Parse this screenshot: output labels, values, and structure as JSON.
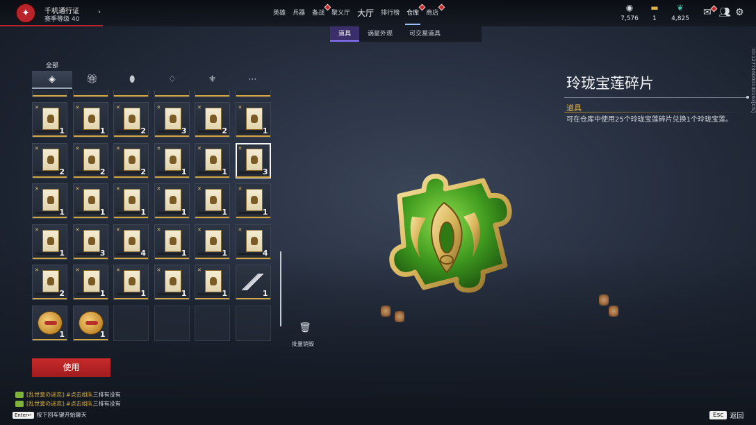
{
  "topbar": {
    "pass_title": "千机通行证",
    "pass_level": "赛季等级 40",
    "nav": [
      {
        "label": "英雄",
        "dot": false,
        "big": false,
        "active": false
      },
      {
        "label": "兵器",
        "dot": false,
        "big": false,
        "active": false
      },
      {
        "label": "备战",
        "dot": true,
        "big": false,
        "active": false
      },
      {
        "label": "聚义厅",
        "dot": false,
        "big": false,
        "active": false
      },
      {
        "label": "大厅",
        "dot": false,
        "big": true,
        "active": false
      },
      {
        "label": "排行榜",
        "dot": false,
        "big": false,
        "active": false
      },
      {
        "label": "仓库",
        "dot": true,
        "big": false,
        "active": true
      },
      {
        "label": "商店",
        "dot": true,
        "big": false,
        "active": false
      }
    ],
    "currencies": [
      {
        "icon": "mask-coin-icon",
        "value": "7,576"
      },
      {
        "icon": "ticket-icon",
        "value": "1"
      },
      {
        "icon": "feather-gem-icon",
        "value": "4,825"
      }
    ]
  },
  "subtabs": [
    {
      "label": "道具",
      "active": true
    },
    {
      "label": "谪星外观",
      "active": false
    },
    {
      "label": "可交易道具",
      "active": false
    }
  ],
  "inventory": {
    "category_label": "全部",
    "categories": [
      "layers-icon",
      "gift-icon",
      "medal-icon",
      "flame-icon",
      "emblem-icon",
      "more-icon"
    ],
    "rows": [
      [
        {
          "t": "card",
          "q": "1"
        },
        {
          "t": "card",
          "q": "1"
        },
        {
          "t": "card",
          "q": "2"
        },
        {
          "t": "card",
          "q": "3"
        },
        {
          "t": "card",
          "q": "2"
        },
        {
          "t": "card",
          "q": "1"
        }
      ],
      [
        {
          "t": "card",
          "q": "2"
        },
        {
          "t": "card",
          "q": "2"
        },
        {
          "t": "card",
          "q": "2"
        },
        {
          "t": "card",
          "q": "1"
        },
        {
          "t": "card",
          "q": "1"
        },
        {
          "t": "card",
          "q": "3",
          "sel": true
        }
      ],
      [
        {
          "t": "card",
          "q": "1"
        },
        {
          "t": "card",
          "q": "1"
        },
        {
          "t": "card",
          "q": "1"
        },
        {
          "t": "card",
          "q": "1"
        },
        {
          "t": "card",
          "q": "1"
        },
        {
          "t": "card",
          "q": "1"
        }
      ],
      [
        {
          "t": "card",
          "q": "1"
        },
        {
          "t": "card",
          "q": "3"
        },
        {
          "t": "card",
          "q": "4"
        },
        {
          "t": "card",
          "q": "1"
        },
        {
          "t": "card",
          "q": "1"
        },
        {
          "t": "card",
          "q": "4"
        }
      ],
      [
        {
          "t": "card",
          "q": "2"
        },
        {
          "t": "card",
          "q": "1"
        },
        {
          "t": "card",
          "q": "1"
        },
        {
          "t": "card",
          "q": "1"
        },
        {
          "t": "card",
          "q": "1"
        },
        {
          "t": "weapon",
          "q": "1"
        }
      ],
      [
        {
          "t": "coin",
          "q": "1"
        },
        {
          "t": "coin",
          "q": "1"
        },
        {
          "t": "empty",
          "q": ""
        },
        {
          "t": "empty",
          "q": ""
        },
        {
          "t": "empty",
          "q": ""
        },
        {
          "t": "empty",
          "q": ""
        }
      ]
    ],
    "batch_destroy": "批量销毁",
    "use_button": "使用"
  },
  "detail": {
    "title": "玲珑宝莲碎片",
    "type": "道具",
    "description": "可在仓库中使用25个玲珑宝莲碎片兑换1个玲珑宝莲。",
    "side_id": "ID:127746000130163[CN]",
    "piece_colors": {
      "jade": "#3f9a1e",
      "gold": "#d8b45a"
    }
  },
  "chat": {
    "lines": [
      {
        "channel": "[乱世寞の迷恋]",
        "hint": ":#点击组队",
        "text": " 三排有没有"
      },
      {
        "channel": "[乱世寞の迷恋]",
        "hint": ":#点击组队",
        "text": " 三排有没有"
      }
    ],
    "enter_key": "Enter↵",
    "enter_hint": "按下回车键开始聊天"
  },
  "footer": {
    "esc_key": "Esc",
    "back_label": "返回"
  }
}
